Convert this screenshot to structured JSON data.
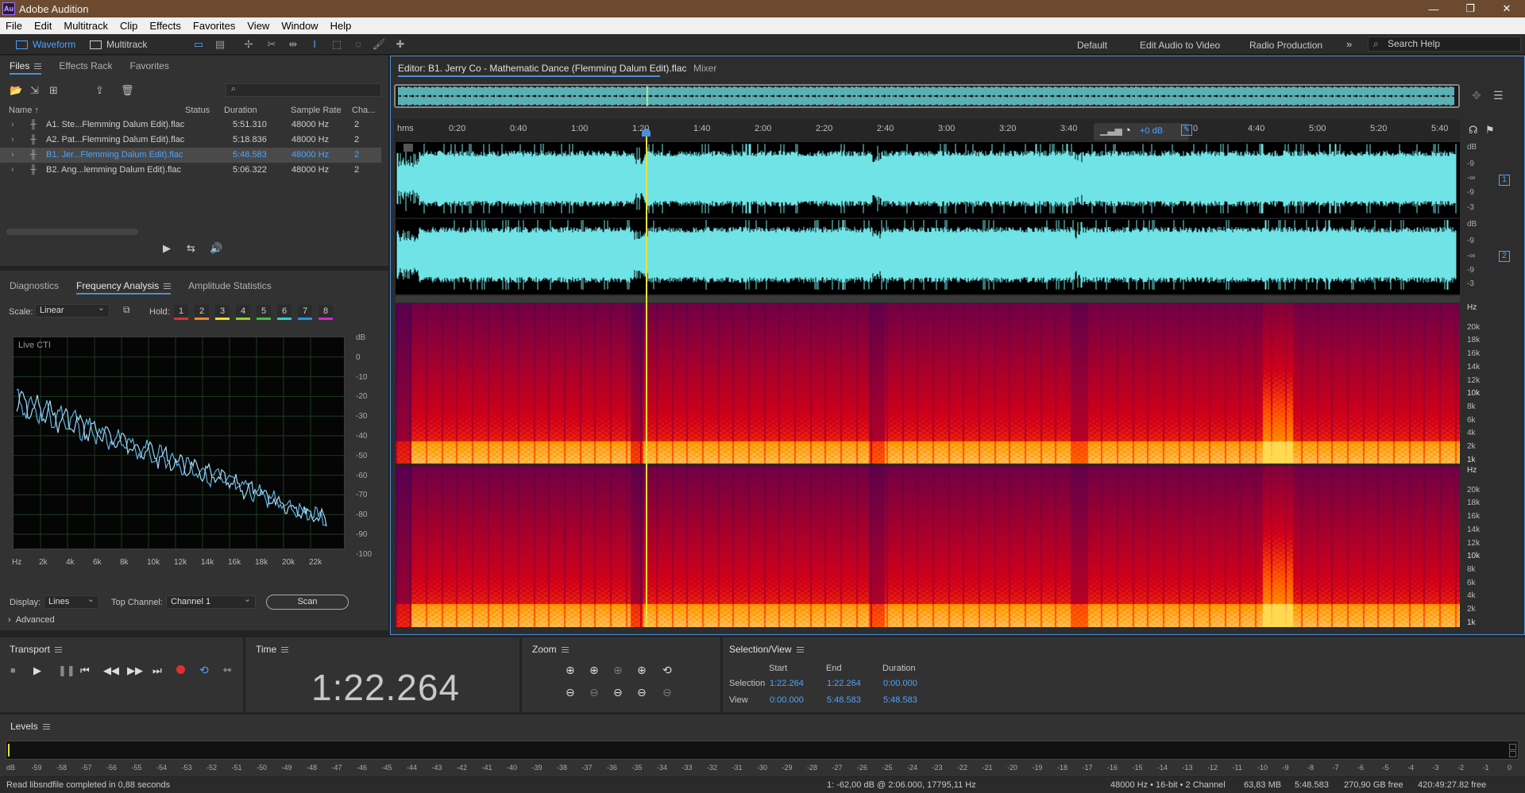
{
  "window": {
    "title": "Adobe Audition",
    "app_icon": "Au"
  },
  "menu": [
    "File",
    "Edit",
    "Multitrack",
    "Clip",
    "Effects",
    "Favorites",
    "View",
    "Window",
    "Help"
  ],
  "toolbar": {
    "modes": [
      "Waveform",
      "Multitrack"
    ],
    "workspaces": [
      "Default",
      "Edit Audio to Video",
      "Radio Production"
    ],
    "overflow": "»",
    "search_placeholder": "Search Help"
  },
  "files_panel": {
    "tabs": [
      "Files",
      "Effects Rack",
      "Favorites"
    ],
    "columns": [
      "Name ↑",
      "Status",
      "Duration",
      "Sample Rate",
      "Cha..."
    ],
    "rows": [
      {
        "name": "A1. Ste...Flemming Dalum Edit).flac",
        "status": "",
        "duration": "5:51.310",
        "rate": "48000 Hz",
        "ch": "2",
        "selected": false
      },
      {
        "name": "A2. Pat...Flemming Dalum Edit).flac",
        "status": "",
        "duration": "5:18.836",
        "rate": "48000 Hz",
        "ch": "2",
        "selected": false
      },
      {
        "name": "B1. Jer...Flemming Dalum Edit).flac",
        "status": "",
        "duration": "5:48.583",
        "rate": "48000 Hz",
        "ch": "2",
        "selected": true
      },
      {
        "name": "B2. Ang...lemming Dalum Edit).flac",
        "status": "",
        "duration": "5:06.322",
        "rate": "48000 Hz",
        "ch": "2",
        "selected": false
      }
    ]
  },
  "freq_panel": {
    "tabs": [
      "Diagnostics",
      "Frequency Analysis",
      "Amplitude Statistics"
    ],
    "scale_label": "Scale:",
    "scale_value": "Linear",
    "hold_label": "Hold:",
    "holds": [
      {
        "label": "1",
        "color": "#e03030"
      },
      {
        "label": "2",
        "color": "#f08a1c"
      },
      {
        "label": "3",
        "color": "#f0e01c"
      },
      {
        "label": "4",
        "color": "#8ed22a"
      },
      {
        "label": "5",
        "color": "#3cc43c"
      },
      {
        "label": "6",
        "color": "#2ad2d2"
      },
      {
        "label": "7",
        "color": "#2a8ef0"
      },
      {
        "label": "8",
        "color": "#d22ad2"
      }
    ],
    "plot_label": "Live CTI",
    "db_ticks": [
      "dB",
      "0",
      "-10",
      "-20",
      "-30",
      "-40",
      "-50",
      "-60",
      "-70",
      "-80",
      "-90",
      "-100"
    ],
    "hz_ticks": [
      "Hz",
      "2k",
      "4k",
      "6k",
      "8k",
      "10k",
      "12k",
      "14k",
      "16k",
      "18k",
      "20k",
      "22k"
    ],
    "display_label": "Display:",
    "display_value": "Lines",
    "top_channel_label": "Top Channel:",
    "top_channel_value": "Channel 1",
    "scan_label": "Scan",
    "advanced_label": "Advanced"
  },
  "editor": {
    "tab_label": "Editor: B1. Jerry Co - Mathematic Dance (Flemming Dalum Edit).flac",
    "mixer_label": "Mixer",
    "ruler_labels": [
      "hms",
      "0:20",
      "0:40",
      "1:00",
      "1:20",
      "1:40",
      "2:00",
      "2:20",
      "2:40",
      "3:00",
      "3:20",
      "3:40",
      "0",
      "4:40",
      "5:00",
      "5:20",
      "5:40"
    ],
    "gain": "+0 dB",
    "db_ticks_ch": [
      "dB",
      "-9",
      "-∞",
      "-9",
      "-3"
    ],
    "channel_badges": [
      "1",
      "2"
    ],
    "hz_ticks": [
      "Hz",
      "20k",
      "18k",
      "16k",
      "14k",
      "12k",
      "10k",
      "8k",
      "6k",
      "4k",
      "2k",
      "1k"
    ],
    "waveform_color": "#6fe3e6",
    "playhead_color": "#e8e23c"
  },
  "transport": {
    "title": "Transport"
  },
  "time_panel": {
    "title": "Time",
    "value": "1:22.264"
  },
  "zoom_panel": {
    "title": "Zoom"
  },
  "selection": {
    "title": "Selection/View",
    "headers": [
      "Start",
      "End",
      "Duration"
    ],
    "rows": [
      {
        "label": "Selection",
        "start": "1:22.264",
        "end": "1:22.264",
        "duration": "0:00.000"
      },
      {
        "label": "View",
        "start": "0:00.000",
        "end": "5:48.583",
        "duration": "5:48.583"
      }
    ]
  },
  "levels": {
    "title": "Levels",
    "ticks": [
      "dB",
      "-59",
      "-58",
      "-57",
      "-56",
      "-55",
      "-54",
      "-53",
      "-52",
      "-51",
      "-50",
      "-49",
      "-48",
      "-47",
      "-46",
      "-45",
      "-44",
      "-43",
      "-42",
      "-41",
      "-40",
      "-39",
      "-38",
      "-37",
      "-36",
      "-35",
      "-34",
      "-33",
      "-32",
      "-31",
      "-30",
      "-29",
      "-28",
      "-27",
      "-26",
      "-25",
      "-24",
      "-23",
      "-22",
      "-21",
      "-20",
      "-19",
      "-18",
      "-17",
      "-16",
      "-15",
      "-14",
      "-13",
      "-12",
      "-11",
      "-10",
      "-9",
      "-8",
      "-7",
      "-6",
      "-5",
      "-4",
      "-3",
      "-2",
      "-1",
      "0"
    ]
  },
  "status": {
    "message": "Read libsndfile completed in 0,88 seconds",
    "cursor": "1: -62,00 dB @ 2:06.000, 17795,11 Hz",
    "format": "48000 Hz • 16-bit • 2 Channel",
    "size": "63,83 MB",
    "duration": "5:48.583",
    "free": "270,90 GB free",
    "free_time": "420:49:27.82 free"
  }
}
